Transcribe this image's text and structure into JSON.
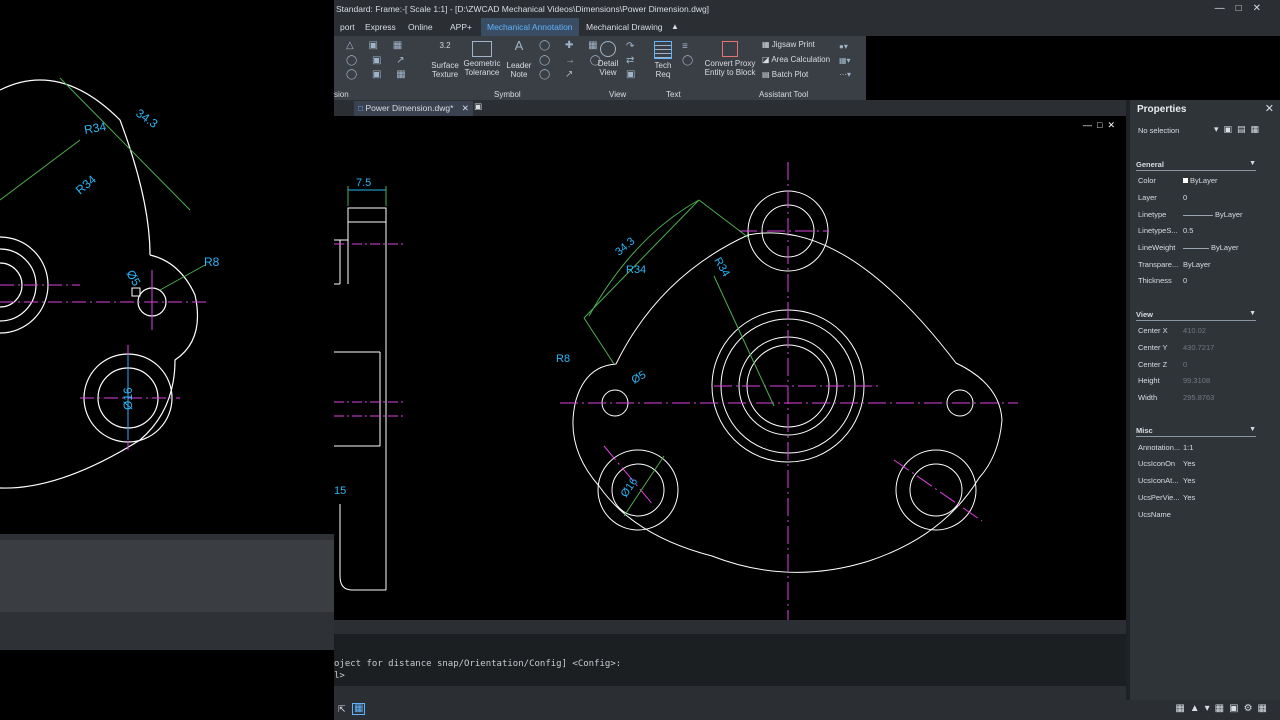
{
  "titlebar": {
    "title": "Standard: Frame:-[ Scale 1:1] - [D:\\ZWCAD Mechanical Videos\\Dimensions\\Power Dimension.dwg]"
  },
  "ribbon": {
    "tabs": [
      "port",
      "Express",
      "Online",
      "APP+",
      "Mechanical Annotation",
      "Mechanical Drawing"
    ],
    "active_tab": "Mechanical Annotation",
    "buttons": {
      "surface_texture": "Surface Texture",
      "geometric_tolerance": "Geometric Tolerance",
      "leader_note": "Leader Note",
      "detail_view": "Detail View",
      "tech_req": "Tech Req",
      "convert_proxy": "Convert Proxy Entity to Block",
      "jigsaw_print": "Jigsaw Print",
      "area_calculation": "Area Calculation",
      "batch_plot": "Batch Plot"
    },
    "groups": {
      "sion": "sion",
      "symbol": "Symbol",
      "view": "View",
      "text": "Text",
      "assistant": "Assistant Tool"
    },
    "surface_icon_text": "3.2"
  },
  "doc_tab": {
    "label": "Power Dimension.dwg*"
  },
  "drawing": {
    "dim_7_5": "7.5",
    "dim_15": "15",
    "dim_34_3": "34.3",
    "dim_r34_a": "R34",
    "dim_r34_b": "R34",
    "dim_r8": "R8",
    "dim_d5": "Ø5",
    "dim_d16": "Ø16",
    "zoom_r34_a": "R34",
    "zoom_r34_b": "R34",
    "zoom_34_3": "34.3",
    "zoom_r8": "R8",
    "zoom_d5": "Ø5",
    "zoom_d16": "Ø16"
  },
  "command_line": {
    "line1": "oject  for distance snap/Orientation/Config] <Config>:",
    "line2": "l>"
  },
  "properties": {
    "title": "Properties",
    "selection": "No selection",
    "sections": {
      "general": "General",
      "view": "View",
      "misc": "Misc"
    },
    "general": [
      {
        "key": "Color",
        "value": "ByLayer"
      },
      {
        "key": "Layer",
        "value": "0"
      },
      {
        "key": "Linetype",
        "value": "ByLayer"
      },
      {
        "key": "LinetypeS...",
        "value": "0.5"
      },
      {
        "key": "LineWeight",
        "value": "ByLayer"
      },
      {
        "key": "Transpare...",
        "value": "ByLayer"
      },
      {
        "key": "Thickness",
        "value": "0"
      }
    ],
    "view": [
      {
        "key": "Center X",
        "value": "410.02"
      },
      {
        "key": "Center Y",
        "value": "430.7217"
      },
      {
        "key": "Center Z",
        "value": "0"
      },
      {
        "key": "Height",
        "value": "99.3108"
      },
      {
        "key": "Width",
        "value": "295.8763"
      }
    ],
    "misc": [
      {
        "key": "Annotation...",
        "value": "1:1"
      },
      {
        "key": "UcsIconOn",
        "value": "Yes"
      },
      {
        "key": "UcsIconAt...",
        "value": "Yes"
      },
      {
        "key": "UcsPerVie...",
        "value": "Yes"
      },
      {
        "key": "UcsName",
        "value": ""
      }
    ]
  },
  "colors": {
    "accent": "#5fb3ff",
    "dimension": "#29b6f6",
    "centerline": "#e040e0",
    "geometry": "#ffffff",
    "extension": "#4caf50"
  }
}
